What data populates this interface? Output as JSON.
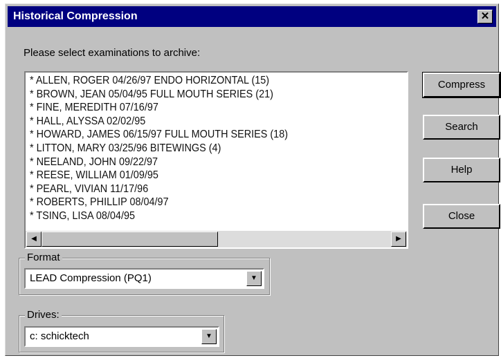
{
  "window": {
    "title": "Historical Compression",
    "close_glyph": "✕"
  },
  "prompt": "Please select examinations to archive:",
  "examinations": [
    "* ALLEN, ROGER 04/26/97 ENDO HORIZONTAL (15)",
    "* BROWN, JEAN 05/04/95 FULL MOUTH SERIES (21)",
    "* FINE, MEREDITH 07/16/97",
    "* HALL, ALYSSA 02/02/95",
    "* HOWARD, JAMES 06/15/97 FULL MOUTH SERIES (18)",
    "* LITTON, MARY 03/25/96 BITEWINGS (4)",
    "* NEELAND, JOHN 09/22/97",
    "* REESE, WILLIAM 01/09/95",
    "* PEARL, VIVIAN 11/17/96",
    "* ROBERTS, PHILLIP 08/04/97",
    "* TSING, LISA 08/04/95"
  ],
  "buttons": {
    "compress": "Compress",
    "search": "Search",
    "help": "Help",
    "close": "Close"
  },
  "format": {
    "label": "Format",
    "value": "LEAD Compression (PQ1)"
  },
  "drives": {
    "label": "Drives:",
    "value": "c: schicktech"
  },
  "colors": {
    "titlebar": "#000080",
    "face": "#c0c0c0"
  },
  "icons": {
    "scroll_left": "triangle-left-icon",
    "scroll_right": "triangle-right-icon",
    "dropdown": "triangle-down-icon"
  }
}
